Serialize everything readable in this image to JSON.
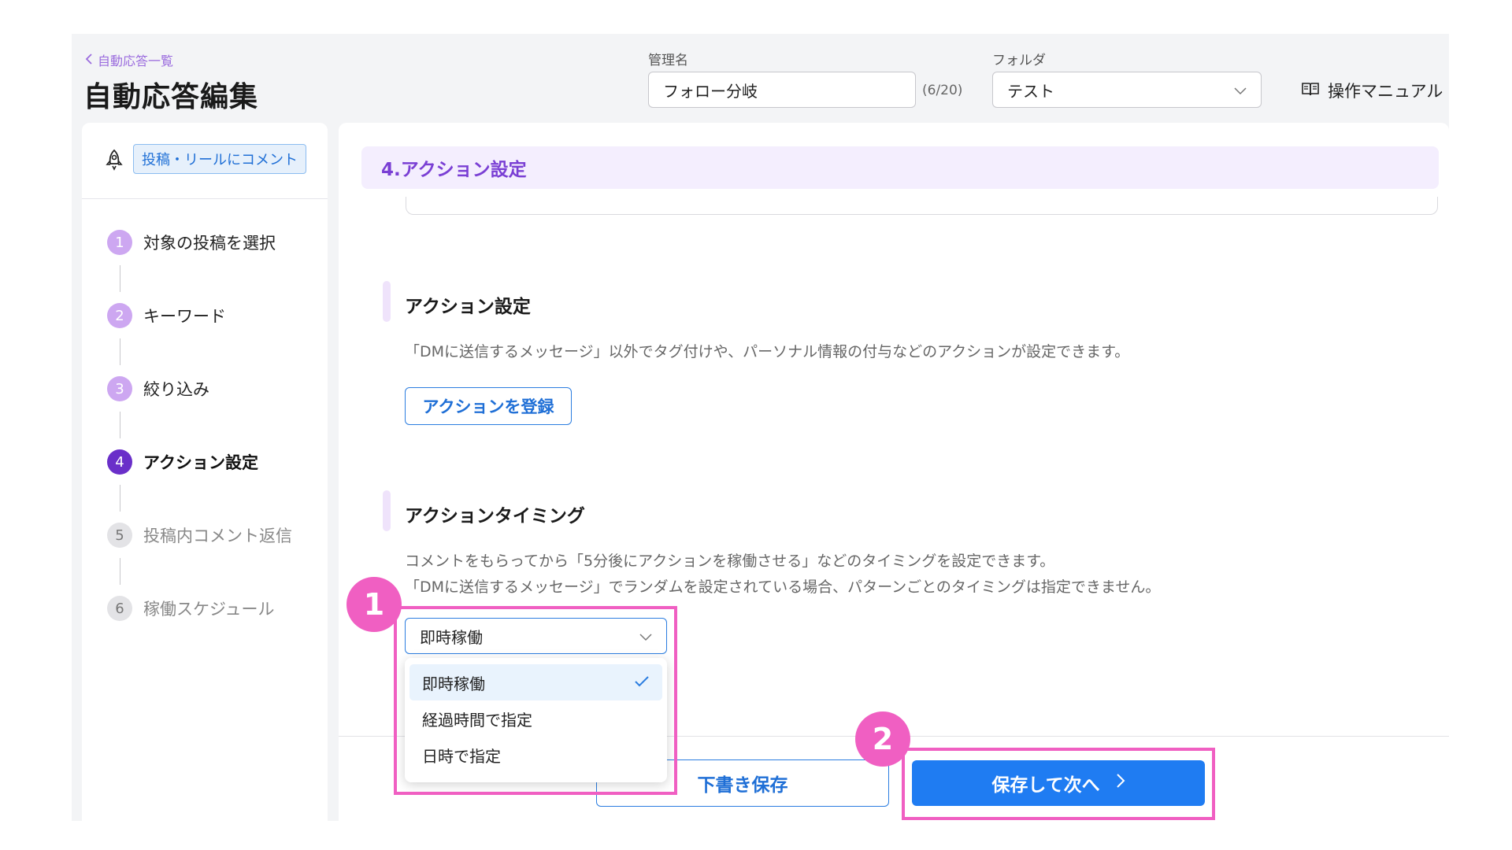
{
  "header": {
    "back_link": "自動応答一覧",
    "page_title": "自動応答編集",
    "management_name_label": "管理名",
    "management_name_value": "フォロー分岐",
    "char_count": "(6/20)",
    "folder_label": "フォルダ",
    "folder_value": "テスト",
    "manual_link": "操作マニュアル"
  },
  "sidebar": {
    "trigger_badge": "投稿・リールにコメント",
    "steps": [
      {
        "num": "1",
        "label": "対象の投稿を選択",
        "state": "done"
      },
      {
        "num": "2",
        "label": "キーワード",
        "state": "done"
      },
      {
        "num": "3",
        "label": "絞り込み",
        "state": "done"
      },
      {
        "num": "4",
        "label": "アクション設定",
        "state": "current"
      },
      {
        "num": "5",
        "label": "投稿内コメント返信",
        "state": "todo"
      },
      {
        "num": "6",
        "label": "稼働スケジュール",
        "state": "todo"
      }
    ]
  },
  "main": {
    "section_title": "4.アクション設定",
    "action_settings": {
      "title": "アクション設定",
      "description": "「DMに送信するメッセージ」以外でタグ付けや、パーソナル情報の付与などのアクションが設定できます。",
      "register_button": "アクションを登録"
    },
    "action_timing": {
      "title": "アクションタイミング",
      "description_line1": "コメントをもらってから「5分後にアクションを稼働させる」などのタイミングを設定できます。",
      "description_line2": "「DMに送信するメッセージ」でランダムを設定されている場合、パターンごとのタイミングは指定できません。",
      "selected_value": "即時稼働",
      "options": [
        "即時稼働",
        "経過時間で指定",
        "日時で指定"
      ]
    },
    "footer": {
      "draft_button": "下書き保存",
      "next_button": "保存して次へ"
    }
  },
  "callouts": [
    "1",
    "2"
  ],
  "colors": {
    "accent_purple": "#7a3fd4",
    "primary_blue": "#1f7cf2",
    "callout_pink": "#f05fc2"
  }
}
